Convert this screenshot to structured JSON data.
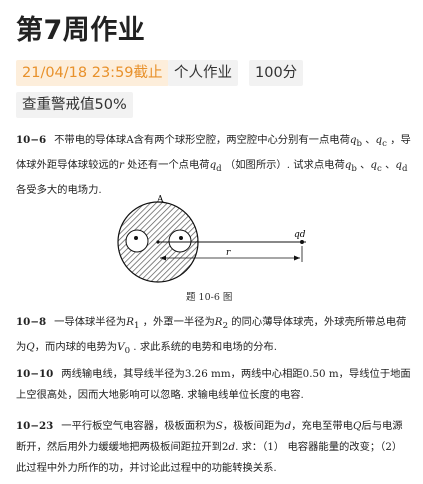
{
  "page": {
    "title": "第7周作业"
  },
  "tags": {
    "deadline": "21/04/18 23:59截止",
    "type": "个人作业",
    "score": "100分",
    "plagiarism": "查重警戒值50%"
  },
  "problems": [
    {
      "number": "10−6",
      "text": "不带电的导体球A含有两个球形空腔，两空腔中心分别有一点电荷qb 、qc ，导体球外距导体球较远的r 处还有一个点电荷qd （如图所示）. 试求点电荷qb 、qc 、qd 各受多大的电场力."
    },
    {
      "number": "10−8",
      "text": "一导体球半径为R1 ，外罩一半径为R2 的同心薄导体球壳，外球壳所带总电荷为Q，而内球的电势为V0 . 求此系统的电势和电场的分布."
    },
    {
      "number": "10−10",
      "text": "两线输电线，其导线半径为3.26 mm，两线中心相距0.50 m，导线位于地面上空很高处，因而大地影响可以忽略. 求输电线单位长度的电容."
    },
    {
      "number": "10−23",
      "text": "一平行板空气电容器，极板面积为S，极板间距为d，充电至带电Q后与电源断开，然后用外力缓缓地把两极板间距拉开到2d. 求：（1） 电容器能量的改变；（2） 此过程中外力所作的功，并讨论此过程中的功能转换关系."
    }
  ],
  "figure": {
    "label_A": "A",
    "label_qd": "qd",
    "label_r": "r",
    "caption": "题 10-6 图"
  }
}
